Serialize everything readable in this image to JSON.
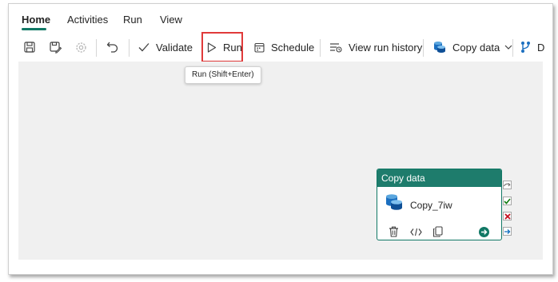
{
  "tabs": [
    {
      "label": "Home",
      "active": true
    },
    {
      "label": "Activities",
      "active": false
    },
    {
      "label": "Run",
      "active": false
    },
    {
      "label": "View",
      "active": false
    }
  ],
  "toolbar": {
    "validate_label": "Validate",
    "run_label": "Run",
    "schedule_label": "Schedule",
    "view_run_history_label": "View run history",
    "copy_data_label": "Copy data",
    "truncated_label": "D"
  },
  "tooltip": {
    "text": "Run (Shift+Enter)"
  },
  "activity": {
    "type_label": "Copy data",
    "name": "Copy_7iw"
  },
  "colors": {
    "accent": "#117865",
    "activity_header": "#1e7c6c",
    "highlight": "#e03a3a",
    "success": "#107c10",
    "failure": "#c50f1f",
    "completion": "#0f6cbd"
  },
  "icons": [
    "save-icon",
    "save-as-icon",
    "settings-icon",
    "undo-icon",
    "checkmark-icon",
    "play-icon",
    "calendar-icon",
    "run-history-icon",
    "database-icon",
    "chevron-down-icon",
    "branch-icon",
    "delete-icon",
    "code-icon",
    "copy-icon",
    "arrow-right-icon",
    "skip-icon",
    "success-icon",
    "fail-icon",
    "completion-icon"
  ]
}
